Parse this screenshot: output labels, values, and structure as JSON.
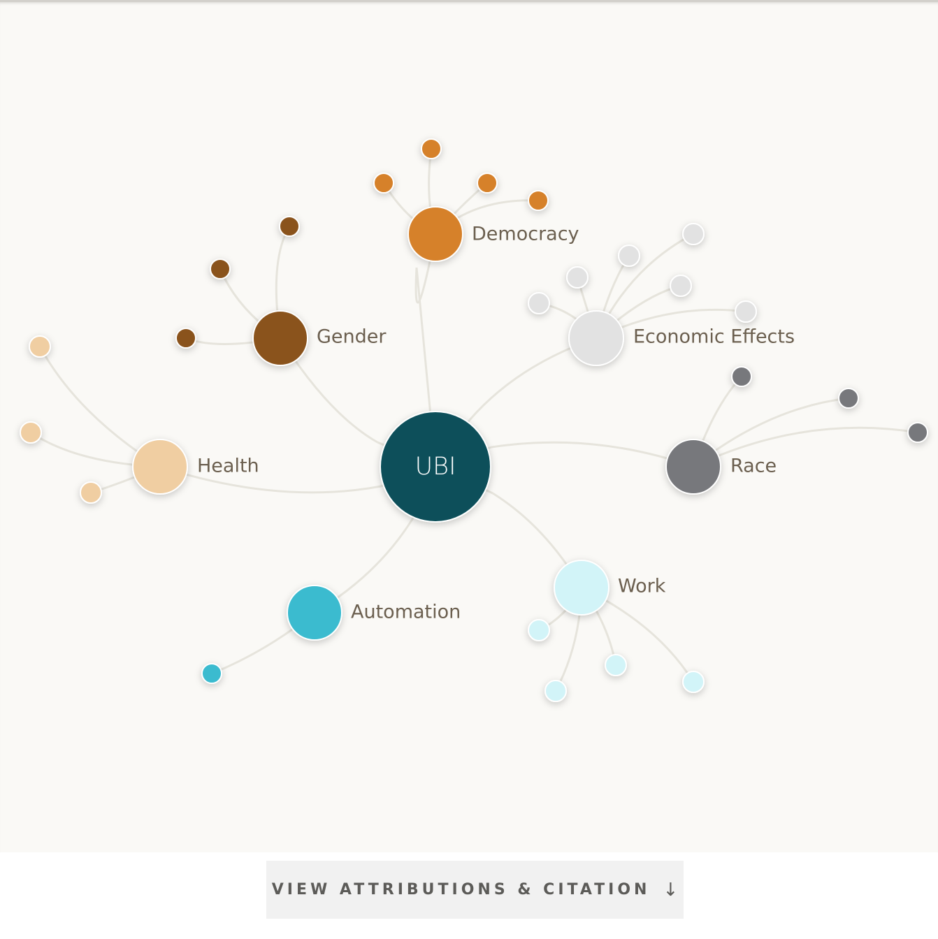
{
  "diagram": {
    "center": {
      "label": "UBI",
      "color": "#08505a"
    },
    "topics": [
      {
        "id": "democracy",
        "label": "Democracy",
        "color": "#d6812a",
        "children": 4
      },
      {
        "id": "gender",
        "label": "Gender",
        "color": "#8a531b",
        "children": 3
      },
      {
        "id": "economic-effects",
        "label": "Economic Effects",
        "color": "#e2e2e2",
        "children": 6
      },
      {
        "id": "health",
        "label": "Health",
        "color": "#f0cea2",
        "children": 3
      },
      {
        "id": "race",
        "label": "Race",
        "color": "#77787c",
        "children": 3
      },
      {
        "id": "automation",
        "label": "Automation",
        "color": "#3bbbcf",
        "children": 1
      },
      {
        "id": "work",
        "label": "Work",
        "color": "#d2f4f8",
        "children": 4
      }
    ]
  },
  "footer": {
    "button_label": "VIEW ATTRIBUTIONS & CITATION",
    "button_icon": "arrow-down-icon",
    "arrow": "↓"
  }
}
